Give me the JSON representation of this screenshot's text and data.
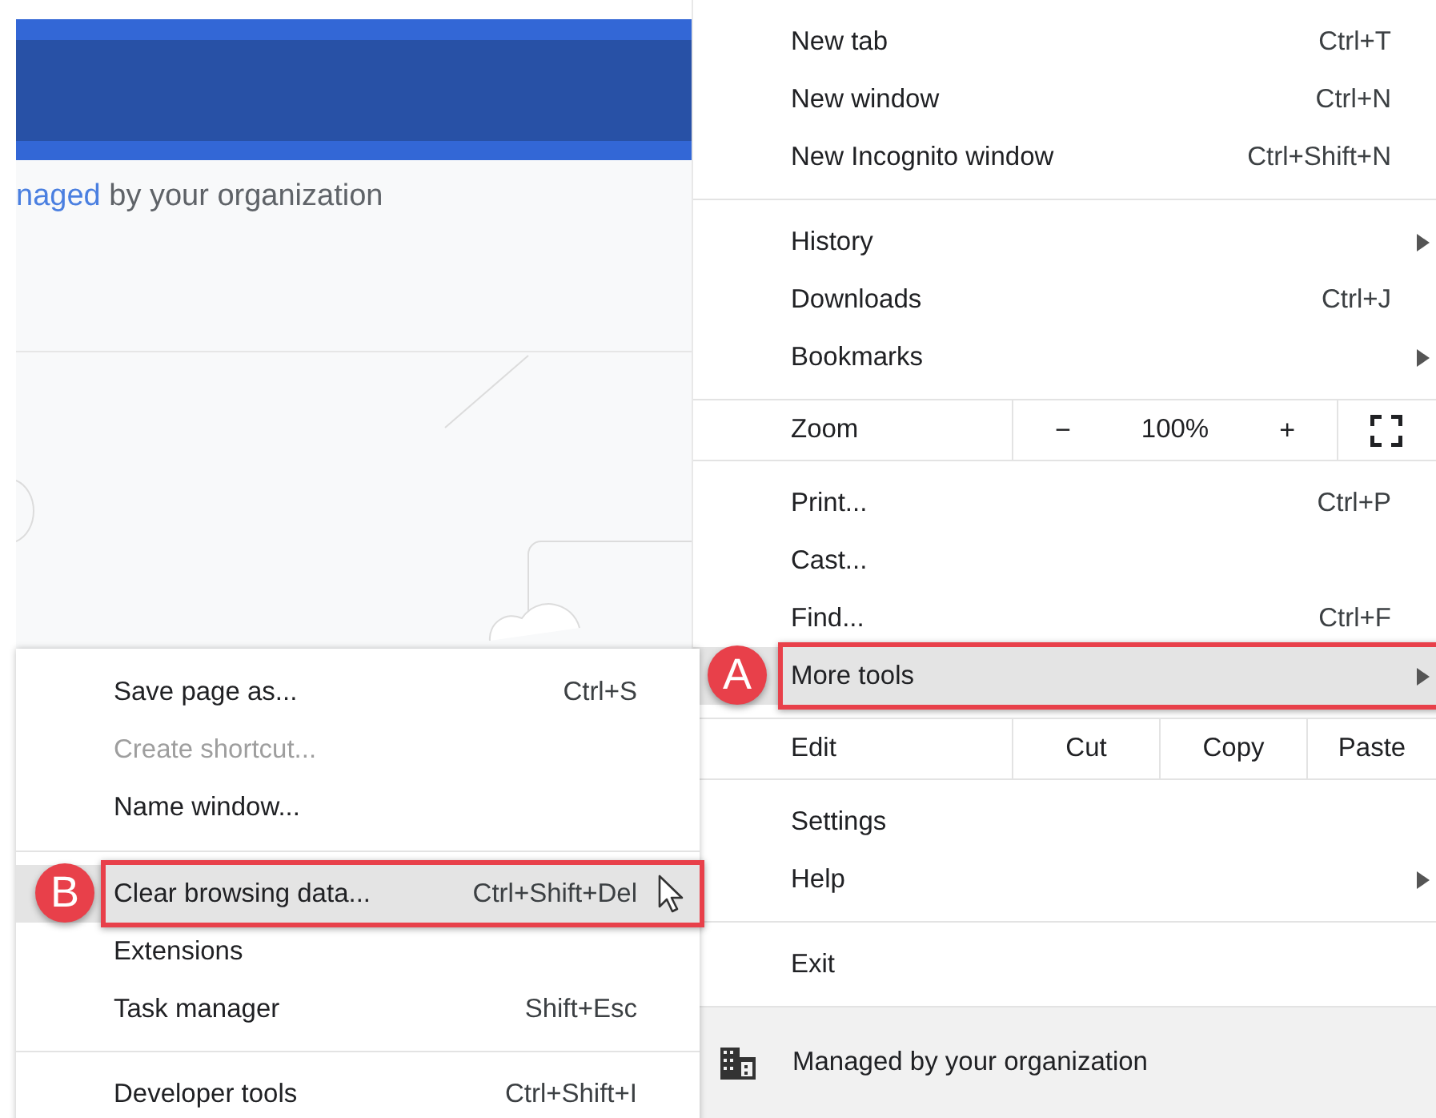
{
  "page": {
    "notice_link": "naged",
    "notice_text": "by your organization"
  },
  "menu": {
    "sections": [
      {
        "kind": "list",
        "items": [
          {
            "label": "New tab",
            "shortcut": "Ctrl+T",
            "has_submenu": false,
            "selected": false
          },
          {
            "label": "New window",
            "shortcut": "Ctrl+N",
            "has_submenu": false,
            "selected": false
          },
          {
            "label": "New Incognito window",
            "shortcut": "Ctrl+Shift+N",
            "has_submenu": false,
            "selected": false
          }
        ]
      },
      {
        "kind": "list",
        "items": [
          {
            "label": "History",
            "has_submenu": true,
            "selected": false
          },
          {
            "label": "Downloads",
            "shortcut": "Ctrl+J",
            "has_submenu": false,
            "selected": false
          },
          {
            "label": "Bookmarks",
            "has_submenu": true,
            "selected": false
          }
        ]
      },
      {
        "kind": "zoom",
        "label": "Zoom",
        "minus": "−",
        "value": "100%",
        "plus": "+"
      },
      {
        "kind": "list",
        "items": [
          {
            "label": "Print...",
            "shortcut": "Ctrl+P",
            "has_submenu": false,
            "selected": false
          },
          {
            "label": "Cast...",
            "has_submenu": false,
            "selected": false
          },
          {
            "label": "Find...",
            "shortcut": "Ctrl+F",
            "has_submenu": false,
            "selected": false
          },
          {
            "label": "More tools",
            "has_submenu": true,
            "selected": true,
            "callout": "A"
          }
        ]
      },
      {
        "kind": "edit",
        "label": "Edit",
        "buttons": [
          "Cut",
          "Copy",
          "Paste"
        ]
      },
      {
        "kind": "list",
        "items": [
          {
            "label": "Settings",
            "has_submenu": false,
            "selected": false
          },
          {
            "label": "Help",
            "has_submenu": true,
            "selected": false
          }
        ]
      },
      {
        "kind": "list",
        "items": [
          {
            "label": "Exit",
            "has_submenu": false,
            "selected": false
          }
        ]
      }
    ],
    "footer": "Managed by your organization"
  },
  "submenu": {
    "sections": [
      {
        "items": [
          {
            "label": "Save page as...",
            "shortcut": "Ctrl+S",
            "selected": false,
            "disabled": false
          },
          {
            "label": "Create shortcut...",
            "selected": false,
            "disabled": true
          },
          {
            "label": "Name window...",
            "selected": false,
            "disabled": false
          }
        ]
      },
      {
        "items": [
          {
            "label": "Clear browsing data...",
            "shortcut": "Ctrl+Shift+Del",
            "selected": true,
            "disabled": false,
            "callout": "B"
          },
          {
            "label": "Extensions",
            "selected": false,
            "disabled": false
          },
          {
            "label": "Task manager",
            "shortcut": "Shift+Esc",
            "selected": false,
            "disabled": false
          }
        ]
      },
      {
        "items": [
          {
            "label": "Developer tools",
            "shortcut": "Ctrl+Shift+I",
            "selected": false,
            "disabled": false
          }
        ]
      }
    ]
  }
}
